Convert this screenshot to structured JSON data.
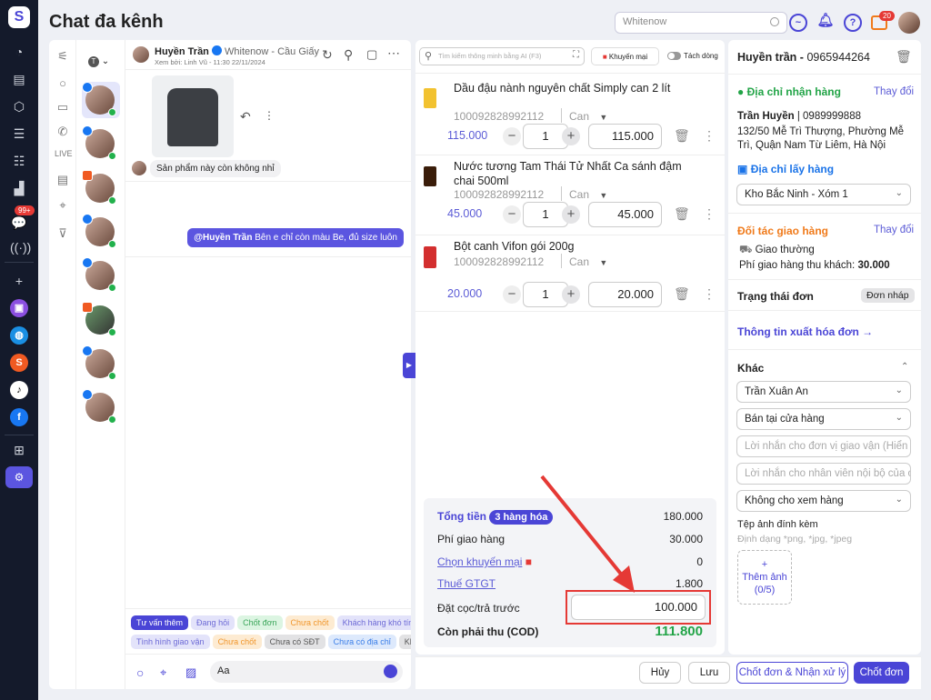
{
  "header": {
    "title": "Chat đa kênh",
    "search_placeholder": "Whitenow",
    "notif_count": "20"
  },
  "sidebar": {
    "chat_badge": "99+"
  },
  "conversation": {
    "name": "Huyền Trần",
    "channel": "Whitenow - Cầu Giấy",
    "seen_by": "Xem bởi: Linh Vũ - 11:30 22/11/2024",
    "avatar_list_filter": "T",
    "messages": [
      {
        "from": "customer",
        "text": "Sản phẩm này còn không nhỉ"
      },
      {
        "from": "agent",
        "mention": "@Huyền Trần",
        "text": "Bên e chỉ còn màu Be, đủ size luôn"
      }
    ],
    "tags_row1": [
      "Tư vấn thêm",
      "Đang hỏi",
      "Chốt đơn",
      "Chưa chốt",
      "Khách hàng khó tính"
    ],
    "tags_row2": [
      "Tình hình giao vận",
      "Chưa chốt",
      "Chưa có SĐT",
      "Chưa có địa chỉ",
      "Khác"
    ],
    "input_placeholder": "Aa"
  },
  "order": {
    "search_placeholder": "Tìm kiếm thông minh bằng AI (F3)",
    "promo_button": "Khuyến mại",
    "split_toggle": "Tách dòng",
    "items": [
      {
        "name": "Dầu đậu nành nguyên chất Simply can 2 lít",
        "sku": "100092828992112",
        "unit": "Can",
        "price": "115.000",
        "qty": "1",
        "total": "115.000"
      },
      {
        "name": "Nước tương Tam Thái Tử Nhất Ca sánh đậm chai 500ml",
        "sku": "100092828992112",
        "unit": "Can",
        "price": "45.000",
        "qty": "1",
        "total": "45.000"
      },
      {
        "name": "Bột canh Vifon gói 200g",
        "sku": "100092828992112",
        "unit": "Can",
        "price": "20.000",
        "qty": "1",
        "total": "20.000"
      }
    ],
    "summary": {
      "total_label": "Tổng tiền",
      "items_badge": "3 hàng hóa",
      "total": "180.000",
      "shipping_label": "Phí giao hàng",
      "shipping": "30.000",
      "promo_label": "Chọn khuyến mại",
      "promo": "0",
      "vat_label": "Thuế GTGT",
      "vat": "1.800",
      "deposit_label": "Đặt cọc/trả trước",
      "deposit": "100.000",
      "cod_label": "Còn phải thu (COD)",
      "cod": "111.800"
    }
  },
  "customer": {
    "name": "Huyền trần",
    "phone": "0965944264",
    "ship_addr_title": "Địa chỉ nhận hàng",
    "change": "Thay đổi",
    "receiver": "Trần Huyền",
    "receiver_phone": "0989999888",
    "address": "132/50 Mễ Trì Thượng, Phường Mễ Trì, Quận Nam Từ Liêm, Hà Nội",
    "pickup_title": "Địa chỉ lấy hàng",
    "pickup": "Kho Bắc Ninh - Xóm 1",
    "partner_title": "Đối tác giao hàng",
    "delivery_type": "Giao thường",
    "fee_label": "Phí giao hàng thu khách:",
    "fee": "30.000",
    "status_label": "Trạng thái đơn",
    "status": "Đơn nháp",
    "invoice": "Thông tin xuất hóa đơn →",
    "other_title": "Khác",
    "staff": "Trần Xuân An",
    "sale_channel": "Bán tại cửa hàng",
    "note_carrier_ph": "Lời nhắn cho đơn vị giao vận (Hiển thị trên đơn)",
    "note_internal_ph": "Lời nhắn cho nhân viên nội bộ của cửa hàng",
    "view_policy": "Không cho xem hàng",
    "attach_title": "Tệp ảnh đính kèm",
    "attach_hint": "Định dạng *png, *jpg, *jpeg",
    "add_image": "Thêm ảnh",
    "add_image_count": "(0/5)"
  },
  "actions": {
    "cancel": "Hủy",
    "save": "Lưu",
    "confirm_process": "Chốt đơn & Nhận xử lý",
    "confirm": "Chốt đơn"
  },
  "colors": {
    "accent": "#4a45d6",
    "green": "#22a447",
    "orange": "#f07a1a",
    "red": "#e53935"
  }
}
